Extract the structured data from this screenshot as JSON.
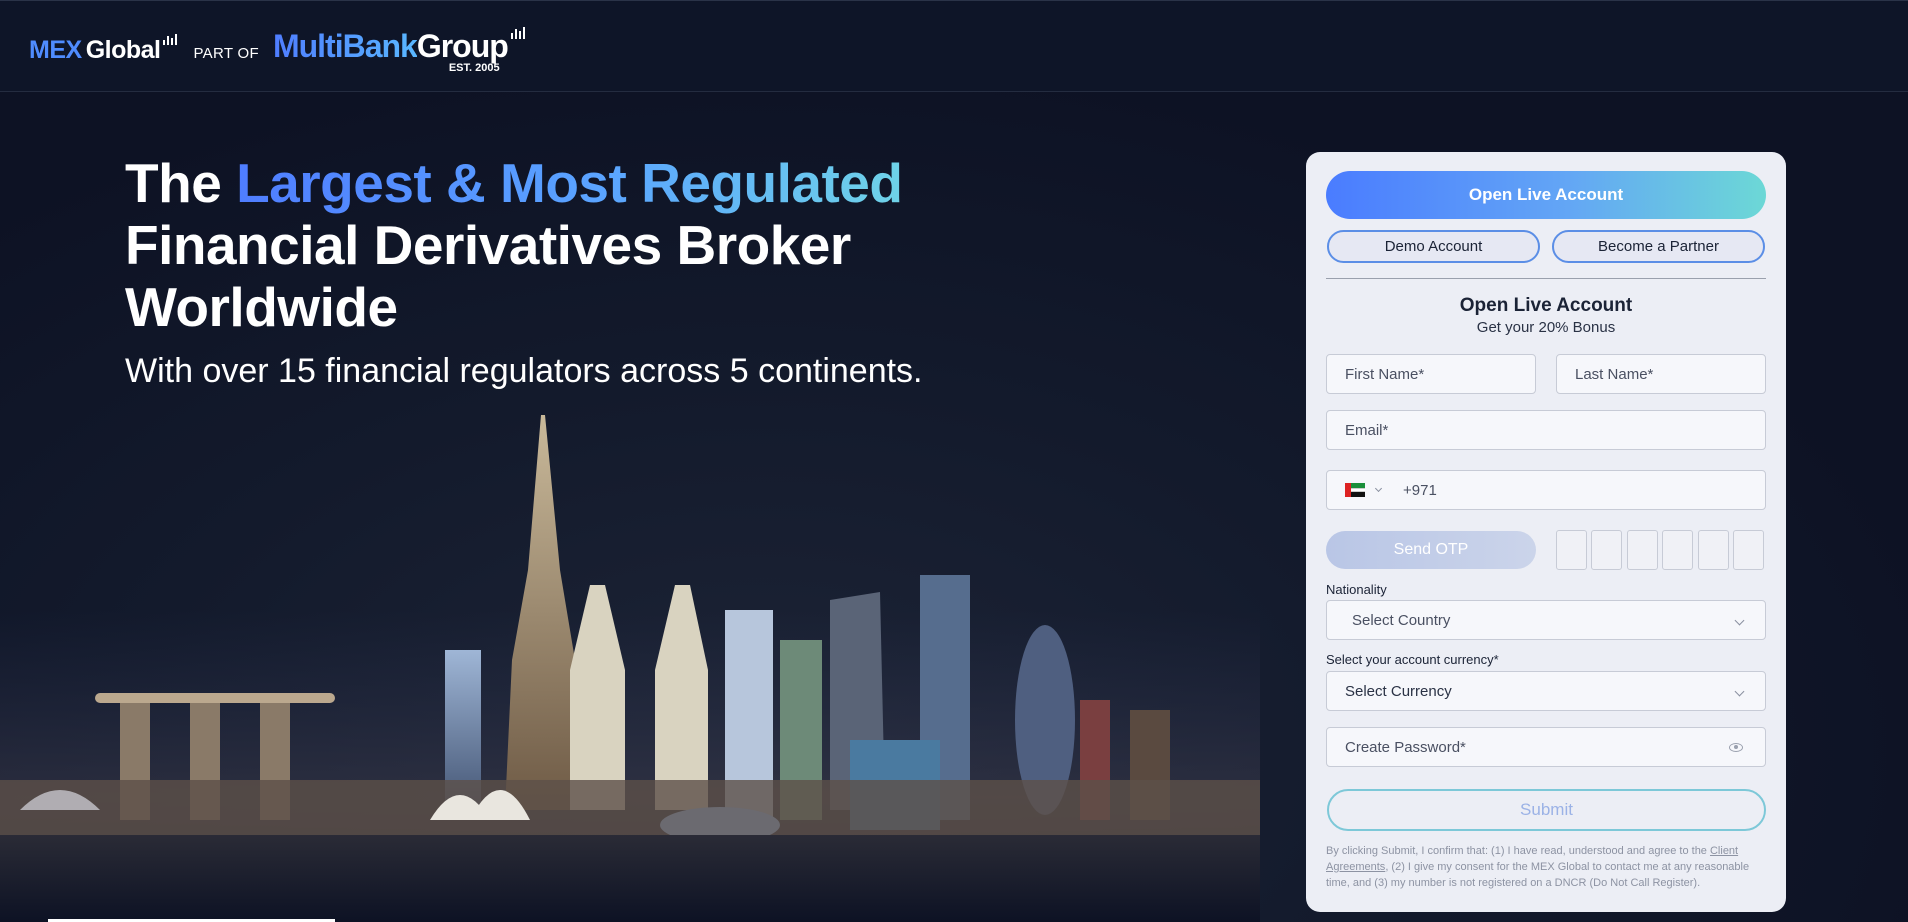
{
  "header": {
    "logo_mex": "MEX",
    "logo_global": "Global",
    "logo_partof": "PART OF",
    "logo_multibank": "MultiBank",
    "logo_group": "Group",
    "logo_est": "EST. 2005"
  },
  "hero": {
    "headline_the": "The",
    "headline_highlight": "Largest & Most Regulated",
    "headline_line2": "Financial Derivatives Broker",
    "headline_line3": "Worldwide",
    "subheadline": "With over 15 financial regulators across 5 continents."
  },
  "form": {
    "open_live_button": "Open Live Account",
    "demo_button": "Demo Account",
    "partner_button": "Become a Partner",
    "title": "Open Live Account",
    "subtitle": "Get your 20% Bonus",
    "first_name_placeholder": "First Name*",
    "last_name_placeholder": "Last Name*",
    "email_placeholder": "Email*",
    "phone_code": "+971",
    "country_flag_icon": "uae-flag-icon",
    "send_otp_button": "Send OTP",
    "nationality_label": "Nationality",
    "nationality_value": "Select Country",
    "currency_label": "Select your account currency*",
    "currency_value": "Select Currency",
    "password_placeholder": "Create Password*",
    "submit_button": "Submit",
    "legal_pre": "By clicking Submit, I confirm that: (1) I have read, understood and agree to the ",
    "legal_link": "Client Agreements",
    "legal_post": ", (2) I give my consent for the MEX Global to contact me at any reasonable time, and (3) my number is not registered on a DNCR (Do Not Call Register)."
  },
  "colors": {
    "accent_blue": "#4a7cff",
    "accent_teal": "#6cd8d6",
    "background": "#0d1224",
    "panel": "#eceef5"
  }
}
